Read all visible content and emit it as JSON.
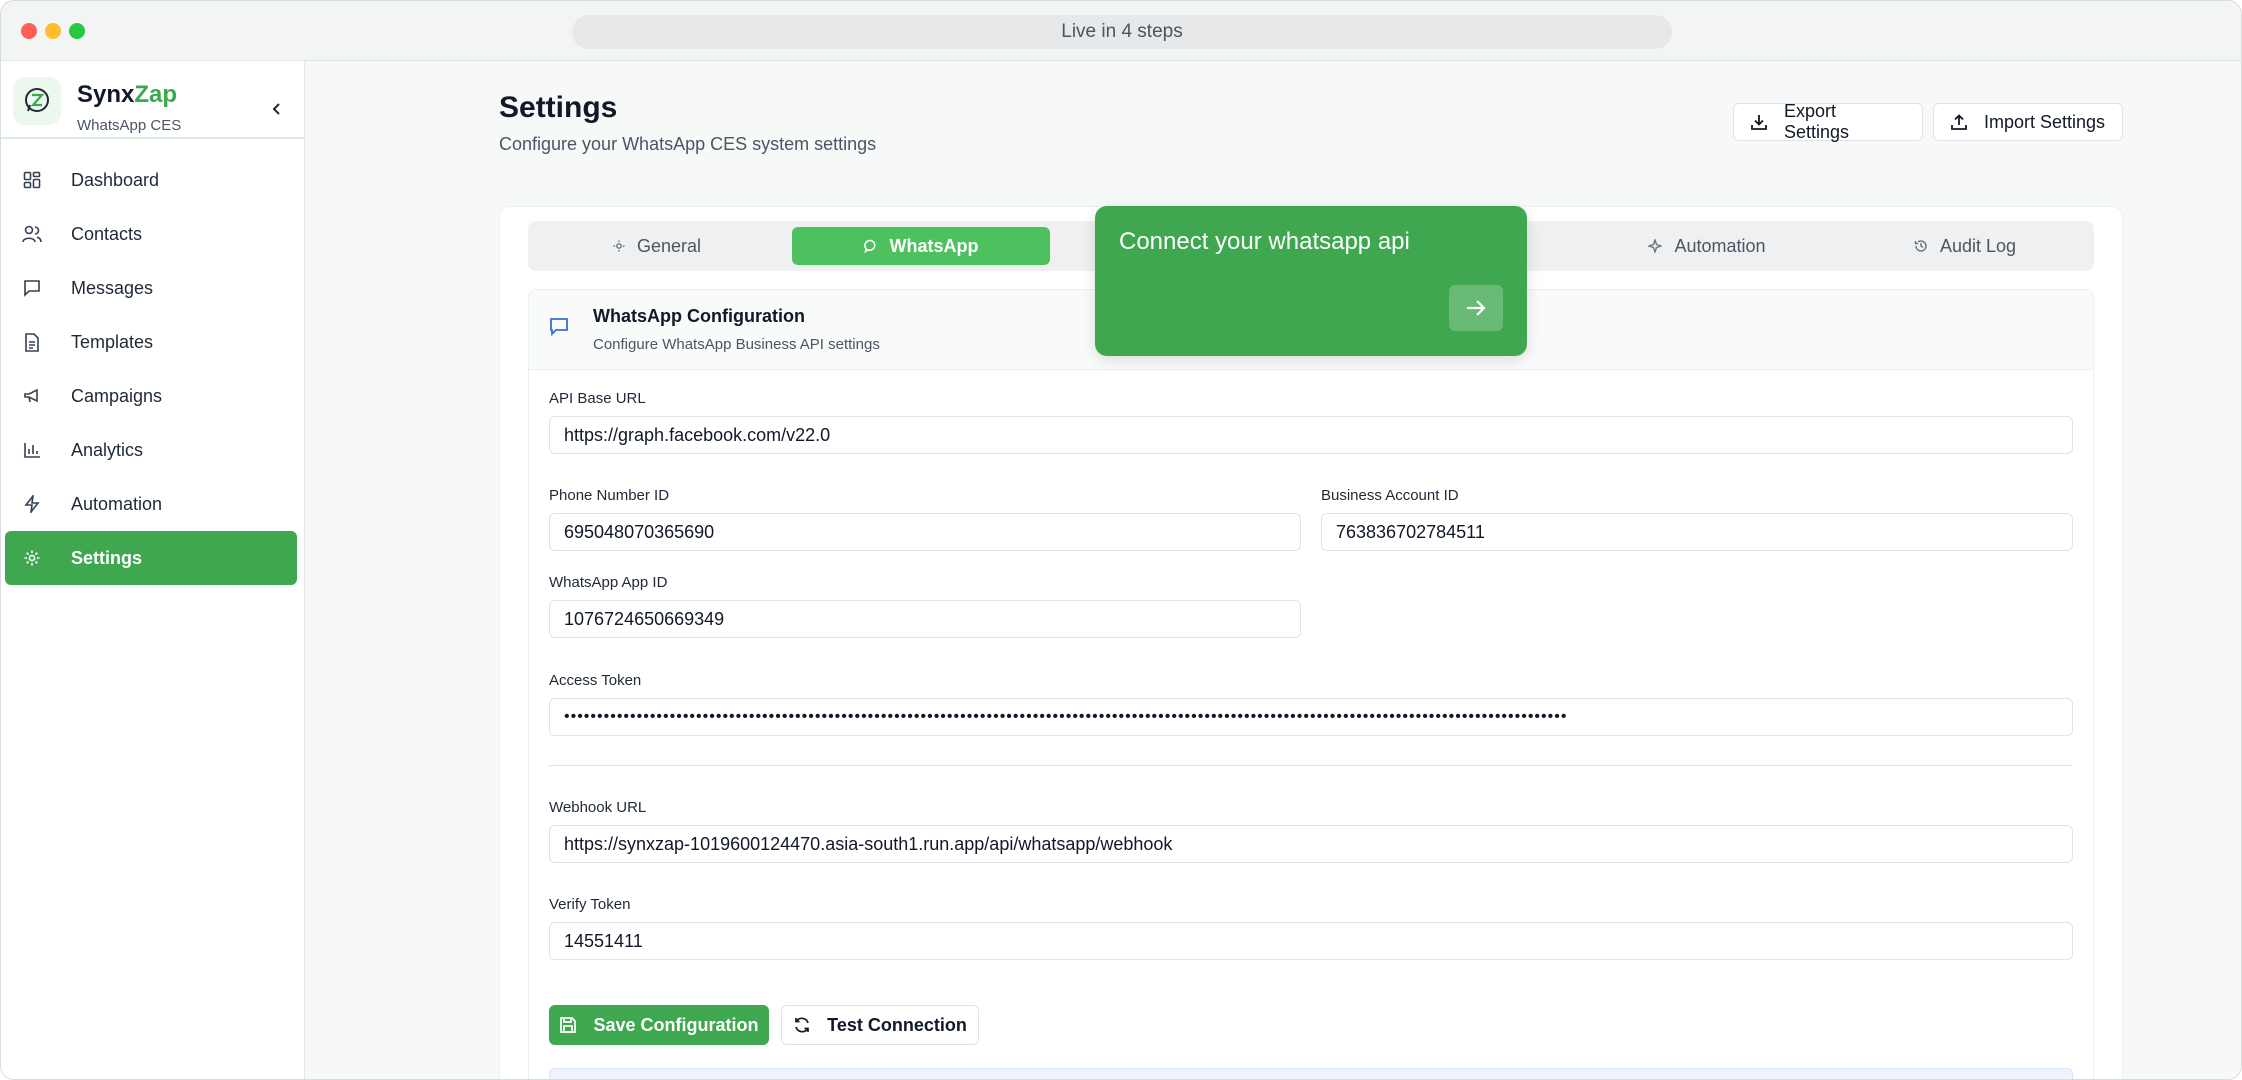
{
  "window": {
    "url_text": "Live in 4 steps"
  },
  "brand": {
    "name_part1": "Synx",
    "name_part2": "Zap",
    "subtitle": "WhatsApp CES",
    "accent_color": "#3aa84c"
  },
  "sidebar": {
    "items": [
      {
        "label": "Dashboard",
        "icon": "grid-icon"
      },
      {
        "label": "Contacts",
        "icon": "users-icon"
      },
      {
        "label": "Messages",
        "icon": "message-icon"
      },
      {
        "label": "Templates",
        "icon": "file-icon"
      },
      {
        "label": "Campaigns",
        "icon": "megaphone-icon"
      },
      {
        "label": "Analytics",
        "icon": "bar-chart-icon"
      },
      {
        "label": "Automation",
        "icon": "zap-icon"
      },
      {
        "label": "Settings",
        "icon": "gear-icon",
        "active": true
      }
    ]
  },
  "header": {
    "title": "Settings",
    "subtitle": "Configure your WhatsApp CES system settings",
    "export_label": "Export Settings",
    "import_label": "Import Settings"
  },
  "tabs": [
    {
      "label": "General",
      "icon": "sun-icon"
    },
    {
      "label": "WhatsApp",
      "icon": "message-icon",
      "active": true
    },
    {
      "label": "Automation",
      "icon": "sparkle-icon"
    },
    {
      "label": "Audit Log",
      "icon": "history-icon"
    }
  ],
  "section": {
    "title": "WhatsApp Configuration",
    "subtitle": "Configure WhatsApp Business API settings"
  },
  "fields": {
    "api_base_url": {
      "label": "API Base URL",
      "value": "https://graph.facebook.com/v22.0"
    },
    "phone_number_id": {
      "label": "Phone Number ID",
      "value": "695048070365690"
    },
    "business_account_id": {
      "label": "Business Account ID",
      "value": "763836702784511"
    },
    "app_id": {
      "label": "WhatsApp App ID",
      "value": "1076724650669349"
    },
    "access_token": {
      "label": "Access Token",
      "value": "••••••••••••••••••••••••••••••••••••••••••••••••••••••••••••••••••••••••••••••••••••••••••••••••••••••••••••••••••••••••••••••••••••••••••••••••••••••••"
    },
    "webhook_url": {
      "label": "Webhook URL",
      "value": "https://synxzap-1019600124470.asia-south1.run.app/api/whatsapp/webhook"
    },
    "verify_token": {
      "label": "Verify Token",
      "value": "14551411"
    }
  },
  "actions": {
    "save_label": "Save Configuration",
    "test_label": "Test Connection"
  },
  "tour": {
    "text": "Connect your whatsapp api"
  }
}
